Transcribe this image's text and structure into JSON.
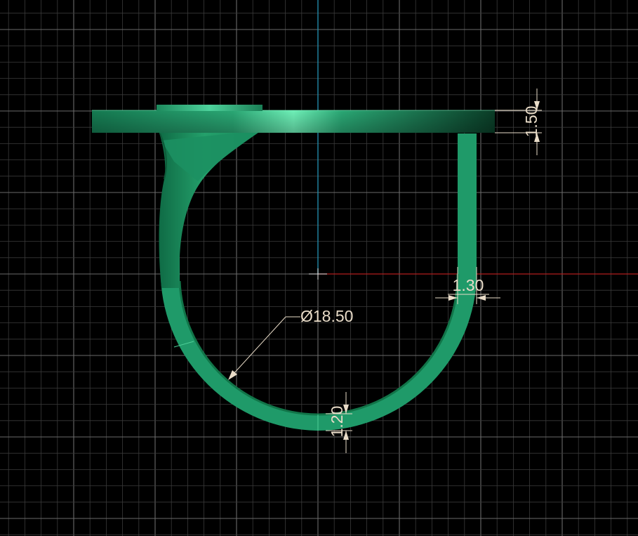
{
  "drawing": {
    "background_color": "#000000",
    "grid_minor_color": "#3a3a3a",
    "grid_major_color": "#6a6a6a",
    "axis_y_color": "#1f8fb0",
    "axis_x_color": "#b01e1e",
    "part_color": "#1f9868",
    "part_highlight_color": "#5fe3ad",
    "part_shadow_color": "#0d5f3d",
    "dimension_color": "#e9dcc8"
  },
  "dimensions": {
    "top_thickness": "1.50",
    "shank_width": "1.30",
    "inner_diameter": "Ø18.50",
    "bottom_thickness": "1.20"
  }
}
